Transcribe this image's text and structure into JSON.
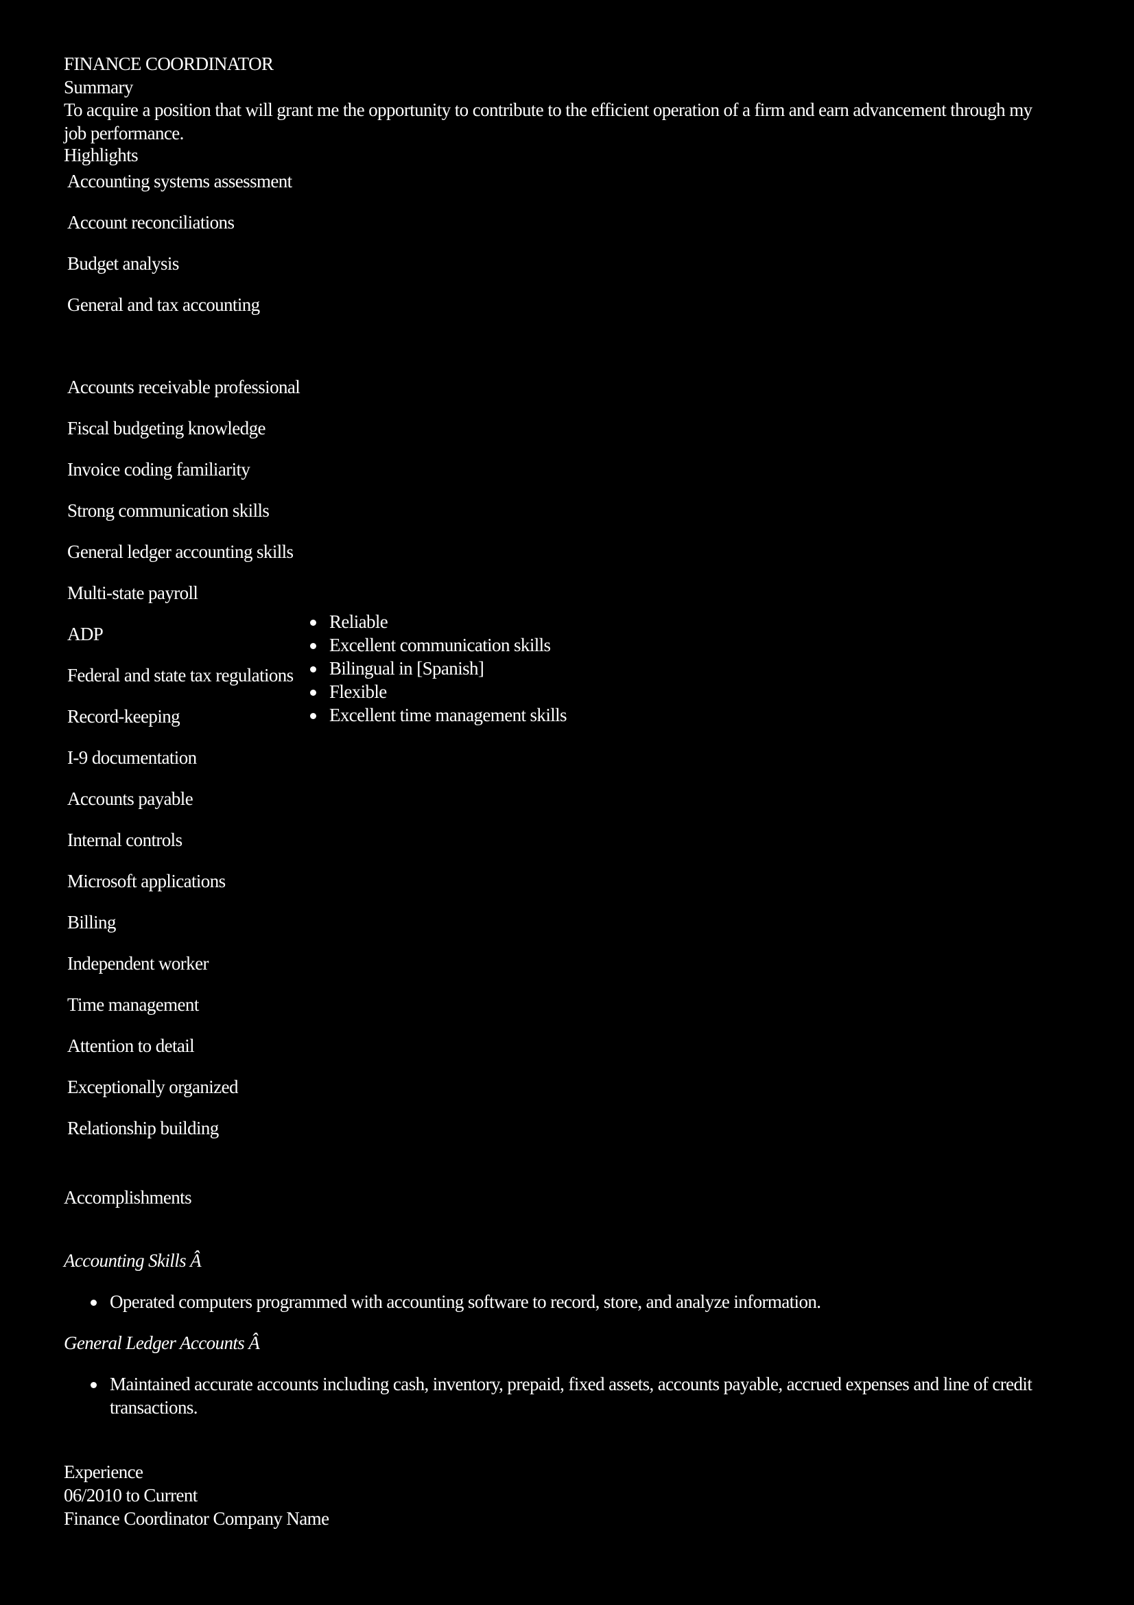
{
  "title": "FINANCE COORDINATOR",
  "summary": {
    "heading": "Summary",
    "text": "To acquire a position that will grant me the opportunity to contribute to the efficient operation of a firm and earn advancement through my job performance."
  },
  "highlights": {
    "heading": "Highlights",
    "left_group_1": [
      "Accounting systems assessment",
      "Account reconciliations",
      "Budget analysis",
      "General and tax accounting"
    ],
    "left_group_2": [
      "Accounts receivable professional",
      "Fiscal budgeting knowledge",
      "Invoice coding familiarity",
      "Strong communication skills",
      "General ledger accounting skills",
      "Multi-state payroll",
      "ADP",
      "Federal and state tax regulations",
      "Record-keeping",
      "I-9 documentation",
      "Accounts payable",
      "Internal controls",
      "Microsoft applications",
      "Billing",
      "Independent worker",
      "Time management",
      "Attention to detail",
      "Exceptionally organized",
      "Relationship building"
    ],
    "right": [
      "Reliable",
      "Excellent communication skills",
      "Bilingual in [Spanish]",
      "Flexible",
      "Excellent time management skills"
    ]
  },
  "accomplishments": {
    "heading": "Accomplishments",
    "sections": [
      {
        "heading": "Accounting Skills Â",
        "items": [
          "Operated computers programmed with accounting software to record, store, and analyze information."
        ]
      },
      {
        "heading": "General Ledger Accounts Â",
        "items": [
          "Maintained accurate accounts including cash, inventory, prepaid, fixed assets, accounts payable, accrued expenses and line of credit transactions."
        ]
      }
    ]
  },
  "experience": {
    "heading": "Experience",
    "dates": "06/2010 to Current",
    "role": "Finance Coordinator Company Name"
  }
}
